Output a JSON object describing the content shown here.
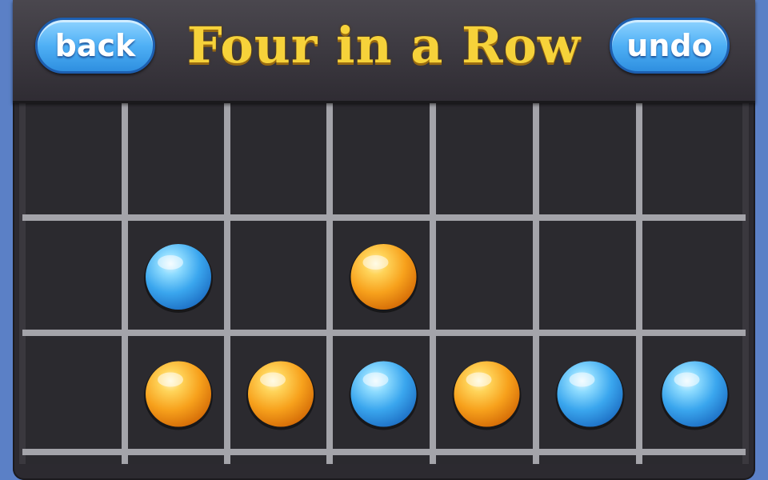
{
  "header": {
    "title": "Four in a Row",
    "back_label": "back",
    "undo_label": "undo"
  },
  "board": {
    "columns": 7,
    "visible_rows": 3,
    "cells": [
      [
        "empty",
        "empty",
        "empty",
        "empty",
        "empty",
        "empty",
        "empty"
      ],
      [
        "empty",
        "blue",
        "empty",
        "orange",
        "empty",
        "empty",
        "empty"
      ],
      [
        "empty",
        "orange",
        "orange",
        "blue",
        "orange",
        "blue",
        "blue"
      ]
    ]
  },
  "colors": {
    "blue_piece": "#4fb7f2",
    "orange_piece": "#f7a11c",
    "grid_line": "#a4a4aa",
    "cell_bg": "#2b2a2f",
    "title_gold": "#f6d23a",
    "button_blue": "#4fb0f5"
  }
}
